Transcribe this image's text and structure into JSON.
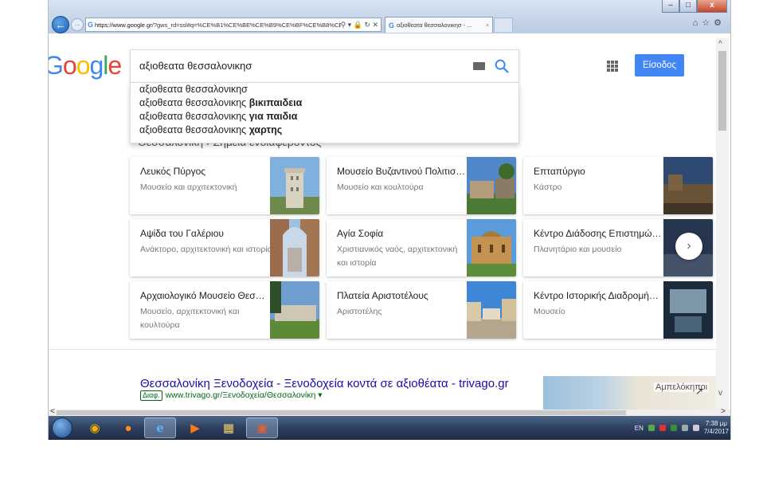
{
  "browser": {
    "url_host": "https://www.google.gr",
    "url_rest": "/?gws_rd=ssl#q=%CE%B1%CE%BE%CE%B9%CE%BF%CE%B8%CE%B5%CE%B1%CF%84%CE%B1",
    "tab_title": "αξιοθεατα θεσσαλονικησ - ...",
    "window_controls": [
      "–",
      "□",
      "x"
    ]
  },
  "google": {
    "search_query": "αξιοθεατα θεσσαλονικησ",
    "signin_label": "Είσοδος",
    "suggestions": [
      {
        "prefix": "αξιοθεατα θεσσαλονικησ",
        "bold": ""
      },
      {
        "prefix": "αξιοθεατα θεσσαλονικης ",
        "bold": "βικιπαιδεια"
      },
      {
        "prefix": "αξιοθεατα θεσσαλονικης ",
        "bold": "για παιδια"
      },
      {
        "prefix": "αξιοθεατα θεσσαλονικης ",
        "bold": "χαρτης"
      }
    ],
    "breadcrumb": "Θεσσαλονίκη › Σημεία ενδιαφέροντος",
    "places": [
      {
        "title": "Λευκός Πύργος",
        "subtitle": "Μουσείο και αρχιτεκτονική"
      },
      {
        "title": "Μουσείο Βυζαντινού Πολιτισμού...",
        "subtitle": "Μουσείο και κουλτούρα"
      },
      {
        "title": "Επταπύργιο",
        "subtitle": "Κάστρο"
      },
      {
        "title": "Αψίδα του Γαλέριου",
        "subtitle": "Ανάκτορο, αρχιτεκτονική και ιστορία"
      },
      {
        "title": "Αγία Σοφία",
        "subtitle": "Χριστιανικός ναός, αρχιτεκτονική και ιστορία"
      },
      {
        "title": "Κέντρο Διάδοσης Επιστημών &...",
        "subtitle": "Πλανητάριο και μουσείο"
      },
      {
        "title": "Αρχαιολογικό Μουσείο Θεσσαλο...",
        "subtitle": "Μουσείο, αρχιτεκτονική και κουλτούρα"
      },
      {
        "title": "Πλατεία Αριστοτέλους",
        "subtitle": "Αριστοτέλης"
      },
      {
        "title": "Κέντρο Ιστορικής Διαδρομής Εβ...",
        "subtitle": "Μουσείο"
      }
    ],
    "result": {
      "title": "Θεσσαλονίκη Ξενοδοχεία - Ξενοδοχεία κοντά σε αξιοθέατα - trivago.gr",
      "ad_badge": "Διαφ.",
      "url": "www.trivago.gr/Ξενοδοχεία/Θεσσαλονίκη ▾",
      "map_label": "Αμπελόκηποι"
    }
  },
  "taskbar": {
    "language": "EN",
    "time": "7:38 μμ",
    "date": "7/4/2017"
  },
  "icons": [
    "back-arrow-icon",
    "forward-arrow-icon",
    "search-icon",
    "keyboard-icon",
    "apps-grid-icon",
    "chevron-right-icon",
    "expand-icon",
    "home-icon",
    "star-icon",
    "gear-icon",
    "windows-start-icon",
    "chrome-icon",
    "firefox-icon",
    "ie-icon",
    "folder-icon",
    "powerpoint-icon"
  ]
}
